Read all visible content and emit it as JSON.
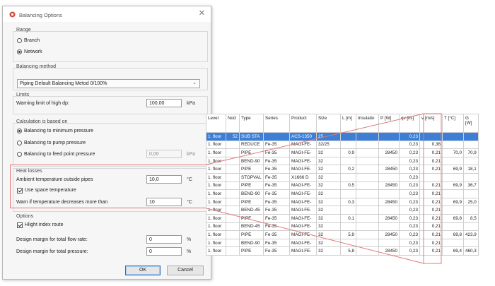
{
  "dialog": {
    "title": "Balancing Options",
    "close_glyph": "✕",
    "range": {
      "label": "Range",
      "options": [
        "Branch",
        "Network"
      ],
      "selected": "Network"
    },
    "method": {
      "label": "Balancing method",
      "value": "Piping Default Balancing Metod 0/100%",
      "chevron": "⌄"
    },
    "limits": {
      "label": "Limits",
      "dp_label": "Warning limit of high dp:",
      "dp_value": "100,00",
      "dp_unit": "kPa"
    },
    "calc": {
      "label": "Calculation is based on",
      "options": [
        "Balancing to minimum pressure",
        "Balancing to pump pressure",
        "Balancing to feed point pressure"
      ],
      "selected": "Balancing to minimum pressure",
      "feed_value": "0,00",
      "feed_unit": "kPa"
    },
    "heat": {
      "label": "Heat losses",
      "ambient_label": "Ambient temperature outside pipes",
      "ambient_value": "10,0",
      "ambient_unit": "°C",
      "space_temp_label": "Use space temperature",
      "space_temp_checked": true,
      "warn_label": "Warn if temperature decreases more than",
      "warn_value": "10",
      "warn_unit": "°C"
    },
    "options": {
      "label": "Options",
      "highlight_label": "Hlight index route",
      "highlight_checked": true,
      "flow_label": "Design margin for total flow rate:",
      "flow_value": "0",
      "flow_unit": "%",
      "pressure_label": "Design margin for total pressure:",
      "pressure_value": "0",
      "pressure_unit": "%"
    },
    "ok_label": "OK",
    "cancel_label": "Cancel"
  },
  "table": {
    "columns": [
      "Level",
      "Nod",
      "Type",
      "Series",
      "Product",
      "Size",
      "L [m]",
      "Insulatio",
      "P [W]",
      "qv [l/s]",
      "v [m/s]",
      "T [°C]",
      "G [W]"
    ],
    "selected_row": 0,
    "rows": [
      [
        "1. floor",
        "52",
        "SUB STA",
        "",
        "ACS-1350",
        "25",
        "",
        "",
        "",
        "0,23",
        "",
        "",
        ""
      ],
      [
        "1. floor",
        "",
        "REDUCE",
        "Fe-35",
        "MAGI-FE-",
        "32/25",
        "",
        "",
        "",
        "0,23",
        "0,36",
        "",
        ""
      ],
      [
        "1. floor",
        "",
        "PIPE",
        "Fe-35",
        "MAGI-FE-",
        "32",
        "0,9",
        "",
        "28450",
        "0,23",
        "0,21",
        "70,0",
        "70,9"
      ],
      [
        "1. floor",
        "",
        "BEND-90",
        "Fe-35",
        "MAGI-FE-",
        "32",
        "",
        "",
        "",
        "0,23",
        "0,21",
        "",
        ""
      ],
      [
        "1. floor",
        "",
        "PIPE",
        "Fe-35",
        "MAGI-FE-",
        "32",
        "0,2",
        "",
        "28450",
        "0,23",
        "0,21",
        "69,9",
        "18,1"
      ],
      [
        "1. floor",
        "",
        "STOPVAL",
        "Fe-35",
        "X1666 D",
        "32",
        "",
        "",
        "",
        "0,23",
        "",
        "",
        ""
      ],
      [
        "1. floor",
        "",
        "PIPE",
        "Fe-35",
        "MAGI-FE-",
        "32",
        "0,5",
        "",
        "28450",
        "0,23",
        "0,21",
        "69,9",
        "36,7"
      ],
      [
        "1. floor",
        "",
        "BEND-90",
        "Fe-35",
        "MAGI-FE-",
        "32",
        "",
        "",
        "",
        "0,23",
        "0,21",
        "",
        ""
      ],
      [
        "1. floor",
        "",
        "PIPE",
        "Fe-35",
        "MAGI-FE-",
        "32",
        "0,3",
        "",
        "28450",
        "0,23",
        "0,21",
        "69,9",
        "25,0"
      ],
      [
        "1. floor",
        "",
        "BEND-45",
        "Fe-35",
        "MAGI-FE-",
        "32",
        "",
        "",
        "",
        "0,23",
        "0,21",
        "",
        ""
      ],
      [
        "1. floor",
        "",
        "PIPE",
        "Fe-35",
        "MAGI-FE-",
        "32",
        "0,1",
        "",
        "28450",
        "0,23",
        "0,21",
        "69,8",
        "8,5"
      ],
      [
        "1. floor",
        "",
        "BEND-45",
        "Fe-35",
        "MAGI-FE-",
        "32",
        "",
        "",
        "",
        "0,23",
        "0,21",
        "",
        ""
      ],
      [
        "1. floor",
        "",
        "PIPE",
        "Fe-35",
        "MAGI-FE-",
        "32",
        "5,9",
        "",
        "28450",
        "0,23",
        "0,21",
        "69,8",
        "423,9"
      ],
      [
        "1. floor",
        "",
        "BEND-90",
        "Fe-35",
        "MAGI-FE-",
        "32",
        "",
        "",
        "",
        "0,23",
        "0,21",
        "",
        ""
      ],
      [
        "1. floor",
        "",
        "PIPE",
        "Fe-35",
        "MAGI-FE-",
        "32",
        "5,8",
        "",
        "28450",
        "0,23",
        "0,21",
        "69,4",
        "460,3"
      ]
    ]
  },
  "colors": {
    "highlight": "#e07a7a",
    "selection": "#3d7fd6"
  }
}
